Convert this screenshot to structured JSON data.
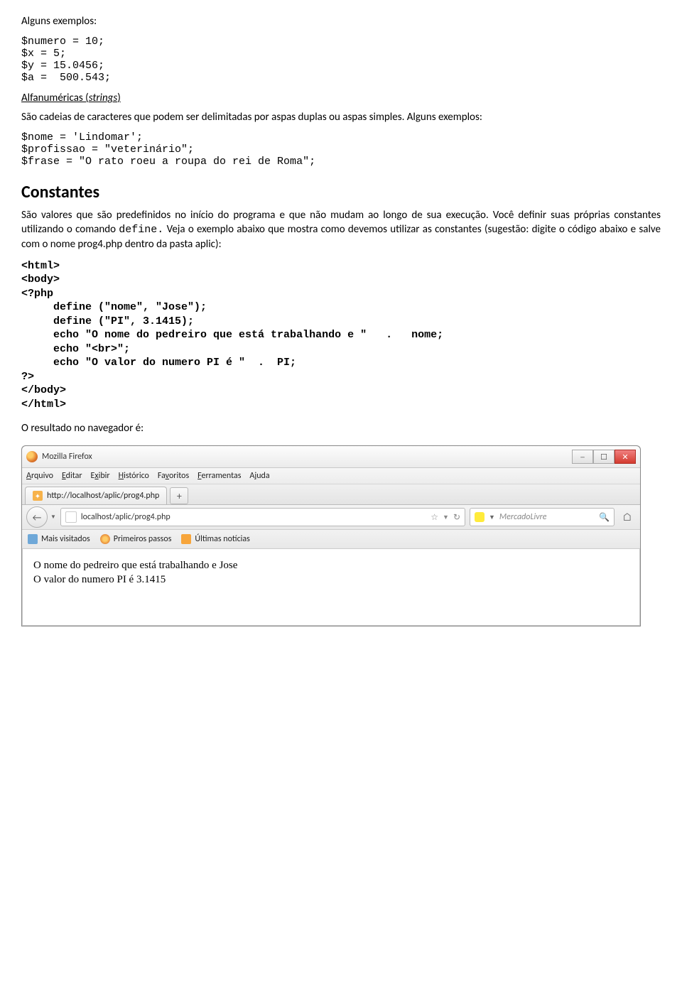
{
  "doc": {
    "p1": "Alguns exemplos:",
    "codeA": "$numero = 10;\n$x = 5;\n$y = 15.0456;\n$a =  500.543;",
    "alfanum_head": "Alfanuméricas (",
    "alfanum_italic": "strings",
    "alfanum_tail": ")",
    "alfanum_desc": "São cadeias de caracteres que podem ser delimitadas por aspas duplas ou aspas simples. Alguns exemplos:",
    "codeB": "$nome = 'Lindomar';\n$profissao = \"veterinário\";\n$frase = \"O rato roeu a roupa do rei de Roma\";",
    "h_const": "Constantes",
    "const_p": "São valores que são predefinidos no início do programa e que não mudam ao longo de sua execução. Você definir suas próprias constantes utilizando o comando ",
    "const_code": "define.",
    "const_p2": "   Veja o exemplo abaixo que mostra como devemos utilizar as constantes (sugestão: digite o código abaixo e salve com o nome  prog4.php dentro da pasta aplic):",
    "codeC": "<html>\n<body>\n<?php\n     define (\"nome\", \"Jose\");\n     define (\"PI\", 3.1415);\n     echo \"O nome do pedreiro que está trabalhando e \"   .   nome;\n     echo \"<br>\";\n     echo \"O valor do numero PI é \"  .  PI;\n?>\n</body>\n</html>",
    "result_label": "O resultado  no navegador é:"
  },
  "browser": {
    "title": "Mozilla Firefox",
    "menus": [
      {
        "label": "Arquivo",
        "key": "A"
      },
      {
        "label": "Editar",
        "key": "E"
      },
      {
        "label": "Exibir",
        "key": "x"
      },
      {
        "label": "Histórico",
        "key": "H"
      },
      {
        "label": "Favoritos",
        "key": "v"
      },
      {
        "label": "Ferramentas",
        "key": "F"
      },
      {
        "label": "Ajuda",
        "key": "j"
      }
    ],
    "tab_label": "http://localhost/aplic/prog4.php",
    "url": "localhost/aplic/prog4.php",
    "search_engine": "MercadoLivre",
    "bookmarks": [
      "Mais visitados",
      "Primeiros passos",
      "Últimas notícias"
    ],
    "page_output_line1": "O nome do pedreiro que está trabalhando e Jose",
    "page_output_line2": "O valor do numero PI é 3.1415"
  }
}
